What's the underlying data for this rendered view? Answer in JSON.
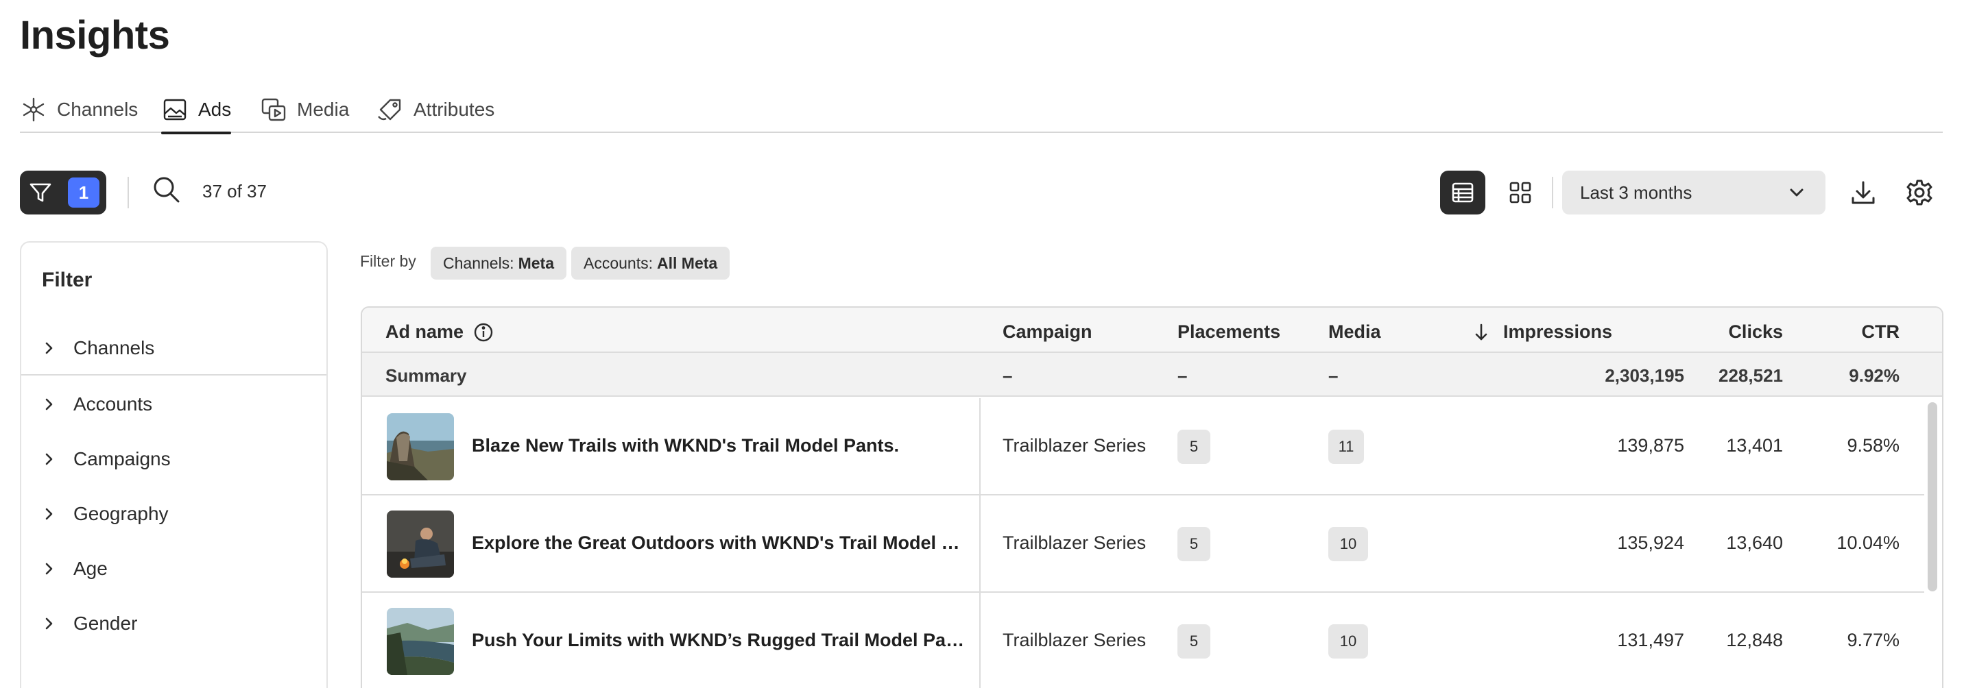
{
  "page": {
    "title": "Insights"
  },
  "tabs": [
    {
      "label": "Channels",
      "icon": "channels-network-icon",
      "active": false
    },
    {
      "label": "Ads",
      "icon": "ads-image-icon",
      "active": true
    },
    {
      "label": "Media",
      "icon": "media-icon",
      "active": false
    },
    {
      "label": "Attributes",
      "icon": "tag-icon",
      "active": false
    }
  ],
  "toolbar": {
    "filter_count": "1",
    "result_count": "37 of 37",
    "date_range": "Last 3 months"
  },
  "filter_panel": {
    "title": "Filter",
    "items": [
      {
        "label": "Channels"
      },
      {
        "label": "Accounts"
      },
      {
        "label": "Campaigns"
      },
      {
        "label": "Geography"
      },
      {
        "label": "Age"
      },
      {
        "label": "Gender"
      }
    ]
  },
  "filter_by": {
    "label": "Filter by",
    "chips": [
      {
        "key": "Channels:",
        "value": "Meta"
      },
      {
        "key": "Accounts:",
        "value": "All Meta"
      }
    ]
  },
  "table": {
    "headers": {
      "ad_name": "Ad name",
      "campaign": "Campaign",
      "placements": "Placements",
      "media": "Media",
      "impressions": "Impressions",
      "clicks": "Clicks",
      "ctr": "CTR"
    },
    "summary": {
      "label": "Summary",
      "campaign": "–",
      "placements": "–",
      "media": "–",
      "impressions": "2,303,195",
      "clicks": "228,521",
      "ctr": "9.92%"
    },
    "rows": [
      {
        "ad_name": "Blaze New Trails with WKND's Trail Model Pants.",
        "campaign": "Trailblazer Series",
        "placements": "5",
        "media": "11",
        "impressions": "139,875",
        "clicks": "13,401",
        "ctr": "9.58%"
      },
      {
        "ad_name": "Explore the Great Outdoors with WKND's Trail Model Pa...",
        "campaign": "Trailblazer Series",
        "placements": "5",
        "media": "10",
        "impressions": "135,924",
        "clicks": "13,640",
        "ctr": "10.04%"
      },
      {
        "ad_name": "Push Your Limits with WKND’s Rugged Trail Model Pants.",
        "campaign": "Trailblazer Series",
        "placements": "5",
        "media": "10",
        "impressions": "131,497",
        "clicks": "12,848",
        "ctr": "9.77%"
      }
    ]
  },
  "colors": {
    "accent": "#4b75ff",
    "dark": "#2c2c2c",
    "chip_bg": "#e6e6e6"
  }
}
